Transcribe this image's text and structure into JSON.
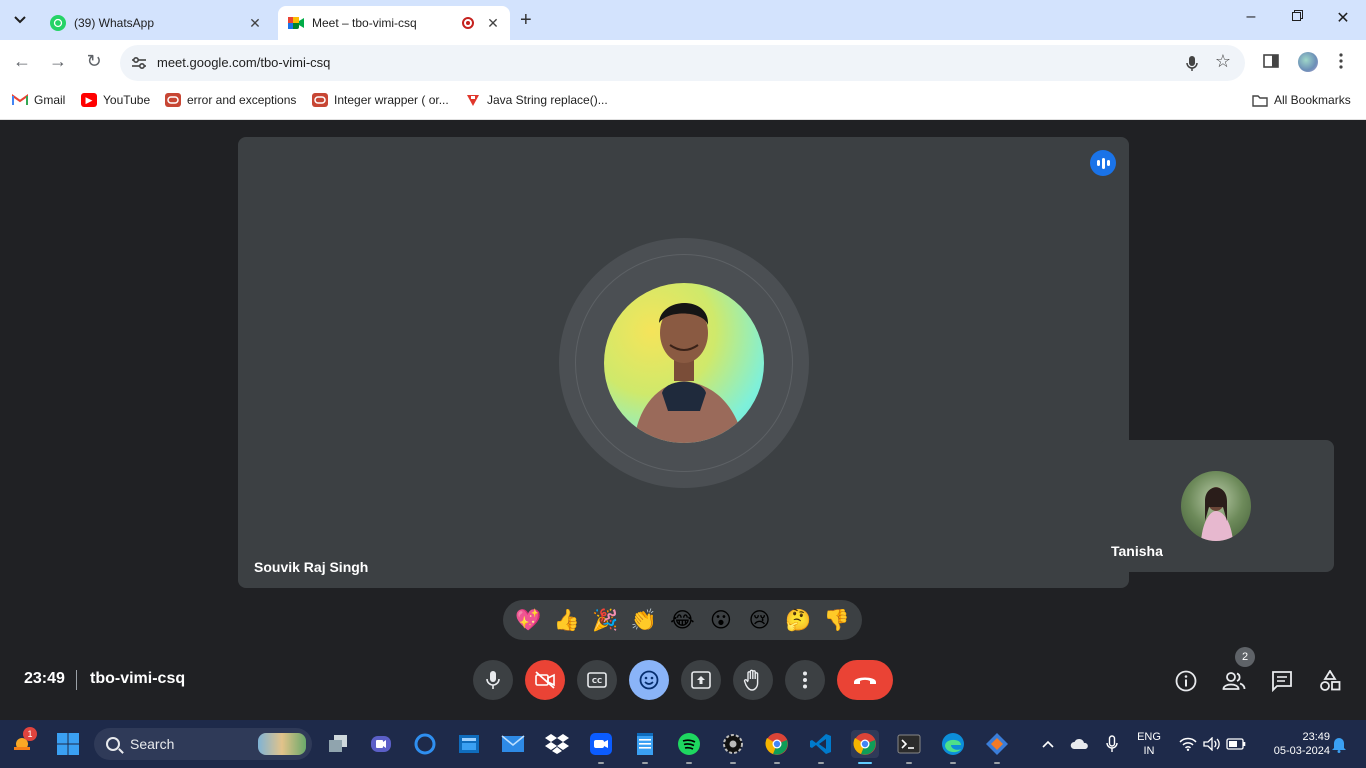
{
  "browser": {
    "tabs": [
      {
        "title": "(39) WhatsApp",
        "badge": "39",
        "active": false
      },
      {
        "title": "Meet – tbo-vimi-csq",
        "active": true,
        "recording": true
      }
    ],
    "url": "meet.google.com/tbo-vimi-csq"
  },
  "bookmarks": {
    "items": [
      "Gmail",
      "YouTube",
      "error and exceptions",
      "Integer wrapper ( or...",
      "Java String replace()..."
    ],
    "all_label": "All Bookmarks"
  },
  "meet": {
    "main_participant": "Souvik Raj Singh",
    "side_participant": "Tanisha",
    "time": "23:49",
    "meeting_code": "tbo-vimi-csq",
    "people_count": "2",
    "reactions": [
      "💖",
      "👍",
      "🎉",
      "👏",
      "😂",
      "😮",
      "😢",
      "🤔",
      "👎"
    ],
    "colors": {
      "end_call": "#ea4335",
      "camera_off": "#ea4335",
      "active_reaction": "#8ab4f8",
      "speaking": "#1a73e8"
    }
  },
  "taskbar": {
    "notification_count": "1",
    "search_placeholder": "Search",
    "language": "ENG",
    "region": "IN",
    "time": "23:49",
    "date": "05-03-2024"
  }
}
